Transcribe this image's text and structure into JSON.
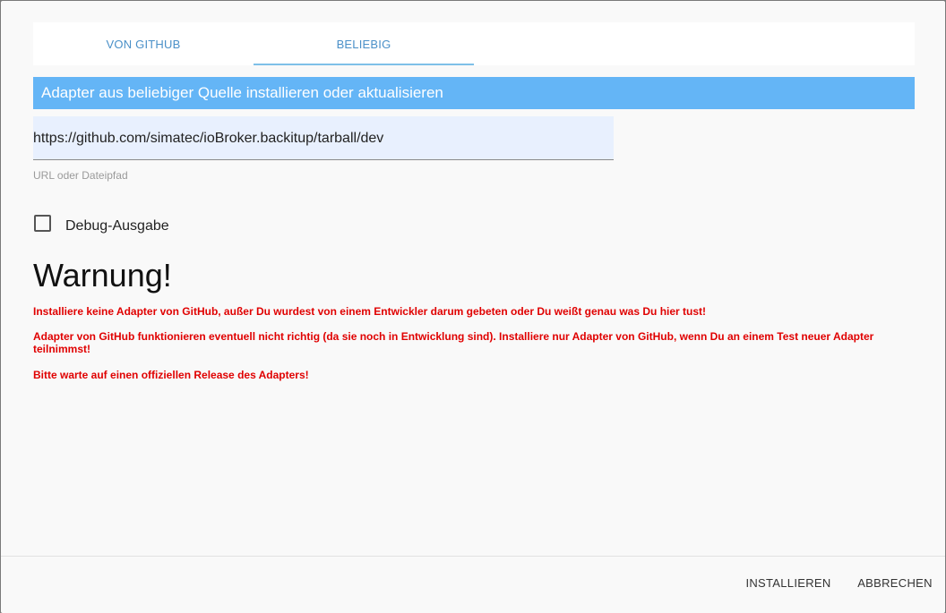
{
  "tabs": [
    {
      "label": "VON GITHUB"
    },
    {
      "label": "BELIEBIG"
    }
  ],
  "header": {
    "title": "Adapter aus beliebiger Quelle installieren oder aktualisieren"
  },
  "url_field": {
    "value": "https://github.com/simatec/ioBroker.backitup/tarball/dev",
    "helper": "URL oder Dateipfad"
  },
  "debug": {
    "label": "Debug-Ausgabe",
    "checked": false
  },
  "warning": {
    "title": "Warnung!",
    "line1": "Installiere keine Adapter von GitHub, außer Du wurdest von einem Entwickler darum gebeten oder Du weißt genau was Du hier tust!",
    "line2": "Adapter von GitHub funktionieren eventuell nicht richtig (da sie noch in Entwicklung sind). Installiere nur Adapter von GitHub, wenn Du an einem Test neuer Adapter teilnimmst!",
    "line3": "Bitte warte auf einen offiziellen Release des Adapters!"
  },
  "actions": {
    "install": "INSTALLIEREN",
    "cancel": "ABBRECHEN"
  },
  "colors": {
    "accent": "#64b5f6",
    "warning": "#e00000",
    "field_bg": "#e8f0fe"
  }
}
